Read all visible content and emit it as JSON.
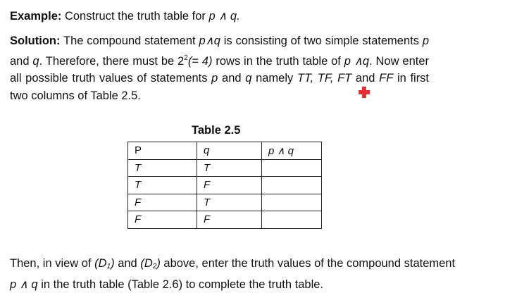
{
  "example": {
    "label": "Example:",
    "text": " Construct the truth table for ",
    "formula": "p ∧ q."
  },
  "solution": {
    "label": "Solution:",
    "t1": " The compound statement ",
    "f1": "p∧q",
    "t2": " is consisting of two simple statements ",
    "p": "p",
    "and": " and ",
    "q": "q",
    "t3": ". Therefore, there must be 2",
    "exp": "2",
    "t4": "(= 4)",
    "t5": " rows in the truth table of ",
    "f2": "p ∧q",
    "t6": ". Now enter all possible truth values of statements ",
    "p2": "p",
    "and2": " and ",
    "q2": "q",
    "t7": " namely ",
    "tt": "TT, TF, FT",
    "and3": " and ",
    "ff": "FF",
    "t8": " in first two columns of Table 2.5."
  },
  "marker": {
    "icon": "red-plus-icon",
    "color": "#e03030"
  },
  "table": {
    "caption": "Table 2.5",
    "headers": [
      "P",
      "q",
      "p ∧ q"
    ],
    "rows": [
      [
        "T",
        "T",
        ""
      ],
      [
        "T",
        "F",
        ""
      ],
      [
        "F",
        "T",
        ""
      ],
      [
        "F",
        "F",
        ""
      ]
    ]
  },
  "then": {
    "t1": "Then, in view of ",
    "d1": "(D",
    "d1sub": "1",
    "d1c": ")",
    "and": " and ",
    "d2": "(D",
    "d2sub": "2",
    "d2c": ")",
    "t2": " above, enter the truth values of the compound statement ",
    "f": "p ∧ q",
    "t3": " in the truth table (Table 2.6) to complete the truth table."
  }
}
